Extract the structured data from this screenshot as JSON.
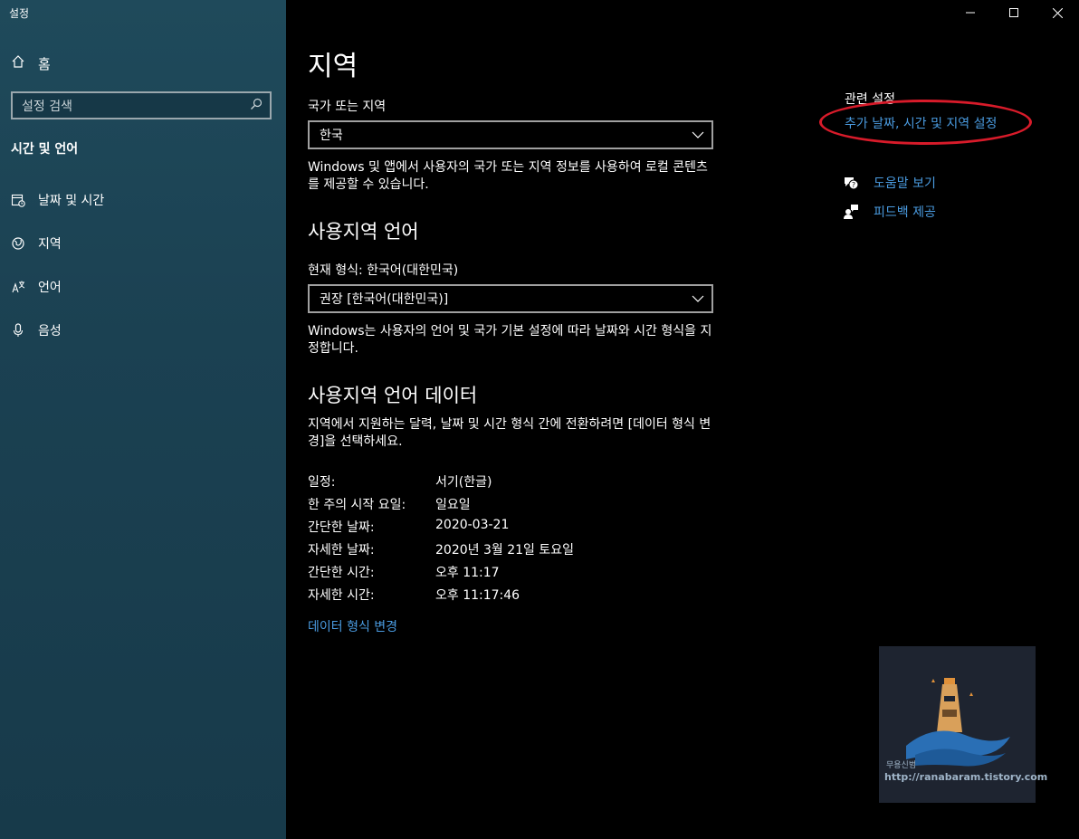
{
  "window": {
    "app_title": "설정",
    "controls": [
      "minimize",
      "maximize",
      "close"
    ]
  },
  "sidebar": {
    "home_label": "홈",
    "search_placeholder": "설정 검색",
    "section_title": "시간 및 언어",
    "items": [
      {
        "label": "날짜 및 시간",
        "icon": "calendar-clock-icon"
      },
      {
        "label": "지역",
        "icon": "globe-icon"
      },
      {
        "label": "언어",
        "icon": "language-icon"
      },
      {
        "label": "음성",
        "icon": "microphone-icon"
      }
    ]
  },
  "main": {
    "title": "지역",
    "country": {
      "label": "국가 또는 지역",
      "value": "한국",
      "description": "Windows 및 앱에서 사용자의 국가 또는 지역 정보를 사용하여 로컬 콘텐츠를 제공할 수 있습니다."
    },
    "regional_format": {
      "heading": "사용지역 언어",
      "current_label": "현재 형식: 한국어(대한민국)",
      "value": "권장 [한국어(대한민국)]",
      "description": "Windows는 사용자의 언어 및 국가 기본 설정에 따라 날짜와 시간 형식을 지정합니다."
    },
    "format_data": {
      "heading": "사용지역 언어 데이터",
      "description": "지역에서 지원하는 달력, 날짜 및 시간 형식 간에 전환하려면 [데이터 형식 변경]을 선택하세요.",
      "rows": [
        {
          "key": "일정:",
          "value": "서기(한글)"
        },
        {
          "key": "한 주의 시작 요일:",
          "value": "일요일"
        },
        {
          "key": "간단한 날짜:",
          "value": "2020-03-21"
        },
        {
          "key": "자세한 날짜:",
          "value": "2020년 3월 21일 토요일"
        },
        {
          "key": "간단한 시간:",
          "value": "오후 11:17"
        },
        {
          "key": "자세한 시간:",
          "value": "오후 11:17:46"
        }
      ],
      "change_link": "데이터 형식 변경"
    }
  },
  "related": {
    "title": "관련 설정",
    "link": "추가 날짜, 시간 및 지역 설정",
    "help_items": [
      {
        "label": "도움말 보기",
        "icon": "help-chat-icon"
      },
      {
        "label": "피드백 제공",
        "icon": "feedback-icon"
      }
    ]
  },
  "watermark": {
    "line1": "무용신범",
    "line2": "http://ranabaram.tistory.com"
  },
  "colors": {
    "accent_link": "#4a9be0",
    "annotation_oval": "#d81b2a",
    "sidebar_bg": "#1b4152"
  }
}
